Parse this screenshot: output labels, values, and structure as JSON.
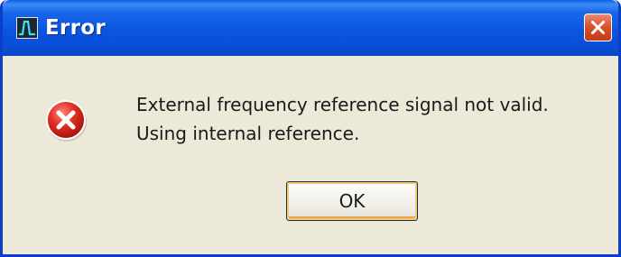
{
  "dialog": {
    "title": "Error",
    "message_lines": [
      "External frequency reference signal not valid.",
      "Using internal reference."
    ],
    "ok_label": "OK",
    "icons": {
      "app": "spectrum-app-icon",
      "close": "close-icon",
      "error": "error-icon"
    }
  },
  "colors": {
    "title_bar": "#0a55e0",
    "window_border": "#0a3fc8",
    "dialog_bg": "#ece9d8",
    "close_button": "#d9532c",
    "error_icon": "#d8201c"
  }
}
